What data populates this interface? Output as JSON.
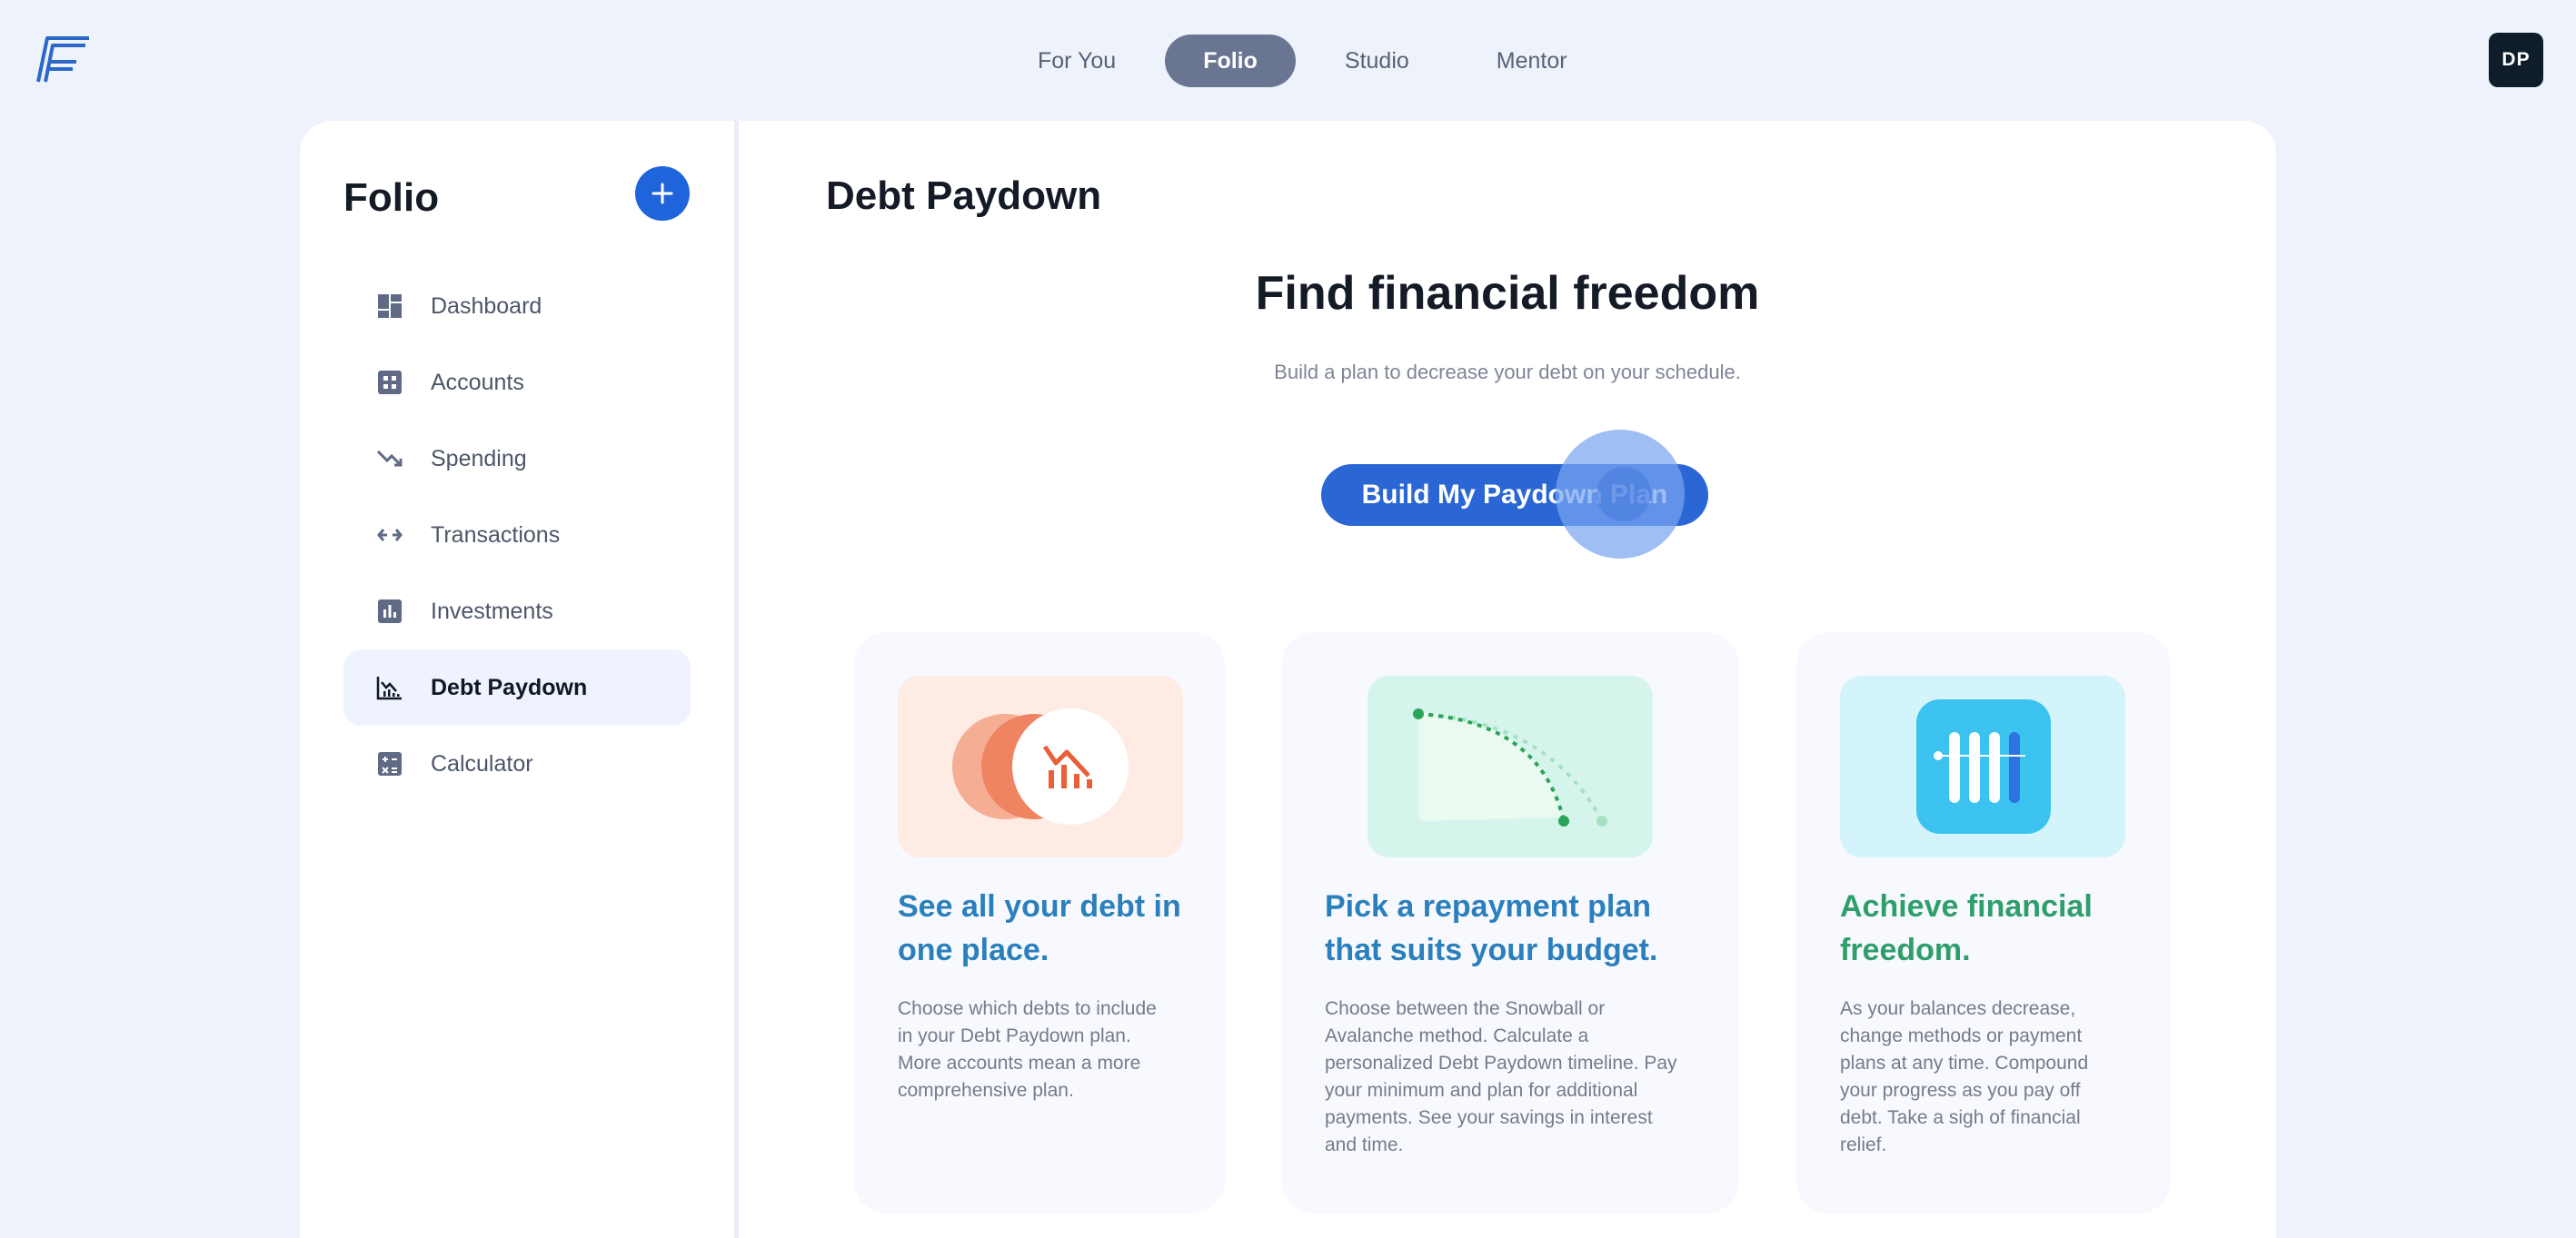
{
  "header": {
    "tabs": [
      {
        "label": "For You"
      },
      {
        "label": "Folio"
      },
      {
        "label": "Studio"
      },
      {
        "label": "Mentor"
      }
    ],
    "active_tab": "Folio",
    "avatar_initials": "DP"
  },
  "sidebar": {
    "title": "Folio",
    "items": [
      {
        "label": "Dashboard",
        "icon": "dashboard-icon"
      },
      {
        "label": "Accounts",
        "icon": "accounts-icon"
      },
      {
        "label": "Spending",
        "icon": "trend-down-icon"
      },
      {
        "label": "Transactions",
        "icon": "arrows-horizontal-icon"
      },
      {
        "label": "Investments",
        "icon": "bar-chart-icon"
      },
      {
        "label": "Debt Paydown",
        "icon": "debt-chart-icon"
      },
      {
        "label": "Calculator",
        "icon": "calculator-icon"
      }
    ],
    "active_item": "Debt Paydown"
  },
  "main": {
    "page_title": "Debt Paydown",
    "hero_title": "Find financial freedom",
    "hero_subtitle": "Build a plan to decrease your debt on your schedule.",
    "cta_label": "Build My Paydown Plan",
    "cards": [
      {
        "heading_line1": "See all your debt in",
        "heading_line2": "one place.",
        "body": [
          "Choose which debts to include",
          "in your Debt Paydown plan.",
          "More accounts mean a more",
          "comprehensive plan."
        ],
        "heading_color": "#2a7fbd"
      },
      {
        "heading_line1": "Pick a repayment plan",
        "heading_line2": "that suits your budget.",
        "body": [
          "Choose between the Snowball or",
          "Avalanche method. Calculate a",
          "personalized Debt Paydown timeline. Pay",
          "your minimum and plan for additional",
          "payments. See your savings in interest",
          "and time."
        ],
        "heading_color": "#2a7fbd"
      },
      {
        "heading_line1": "Achieve financial",
        "heading_line2": "freedom.",
        "body": [
          "As your balances decrease,",
          "change methods or payment",
          "plans at any time. Compound",
          "your progress as you pay off",
          "debt. Take a sigh of financial",
          "relief."
        ],
        "heading_color": "#2e9e6a"
      }
    ]
  },
  "colors": {
    "background": "#eef3fb",
    "accent": "#2064dc",
    "active_tab": "#6a7592"
  }
}
